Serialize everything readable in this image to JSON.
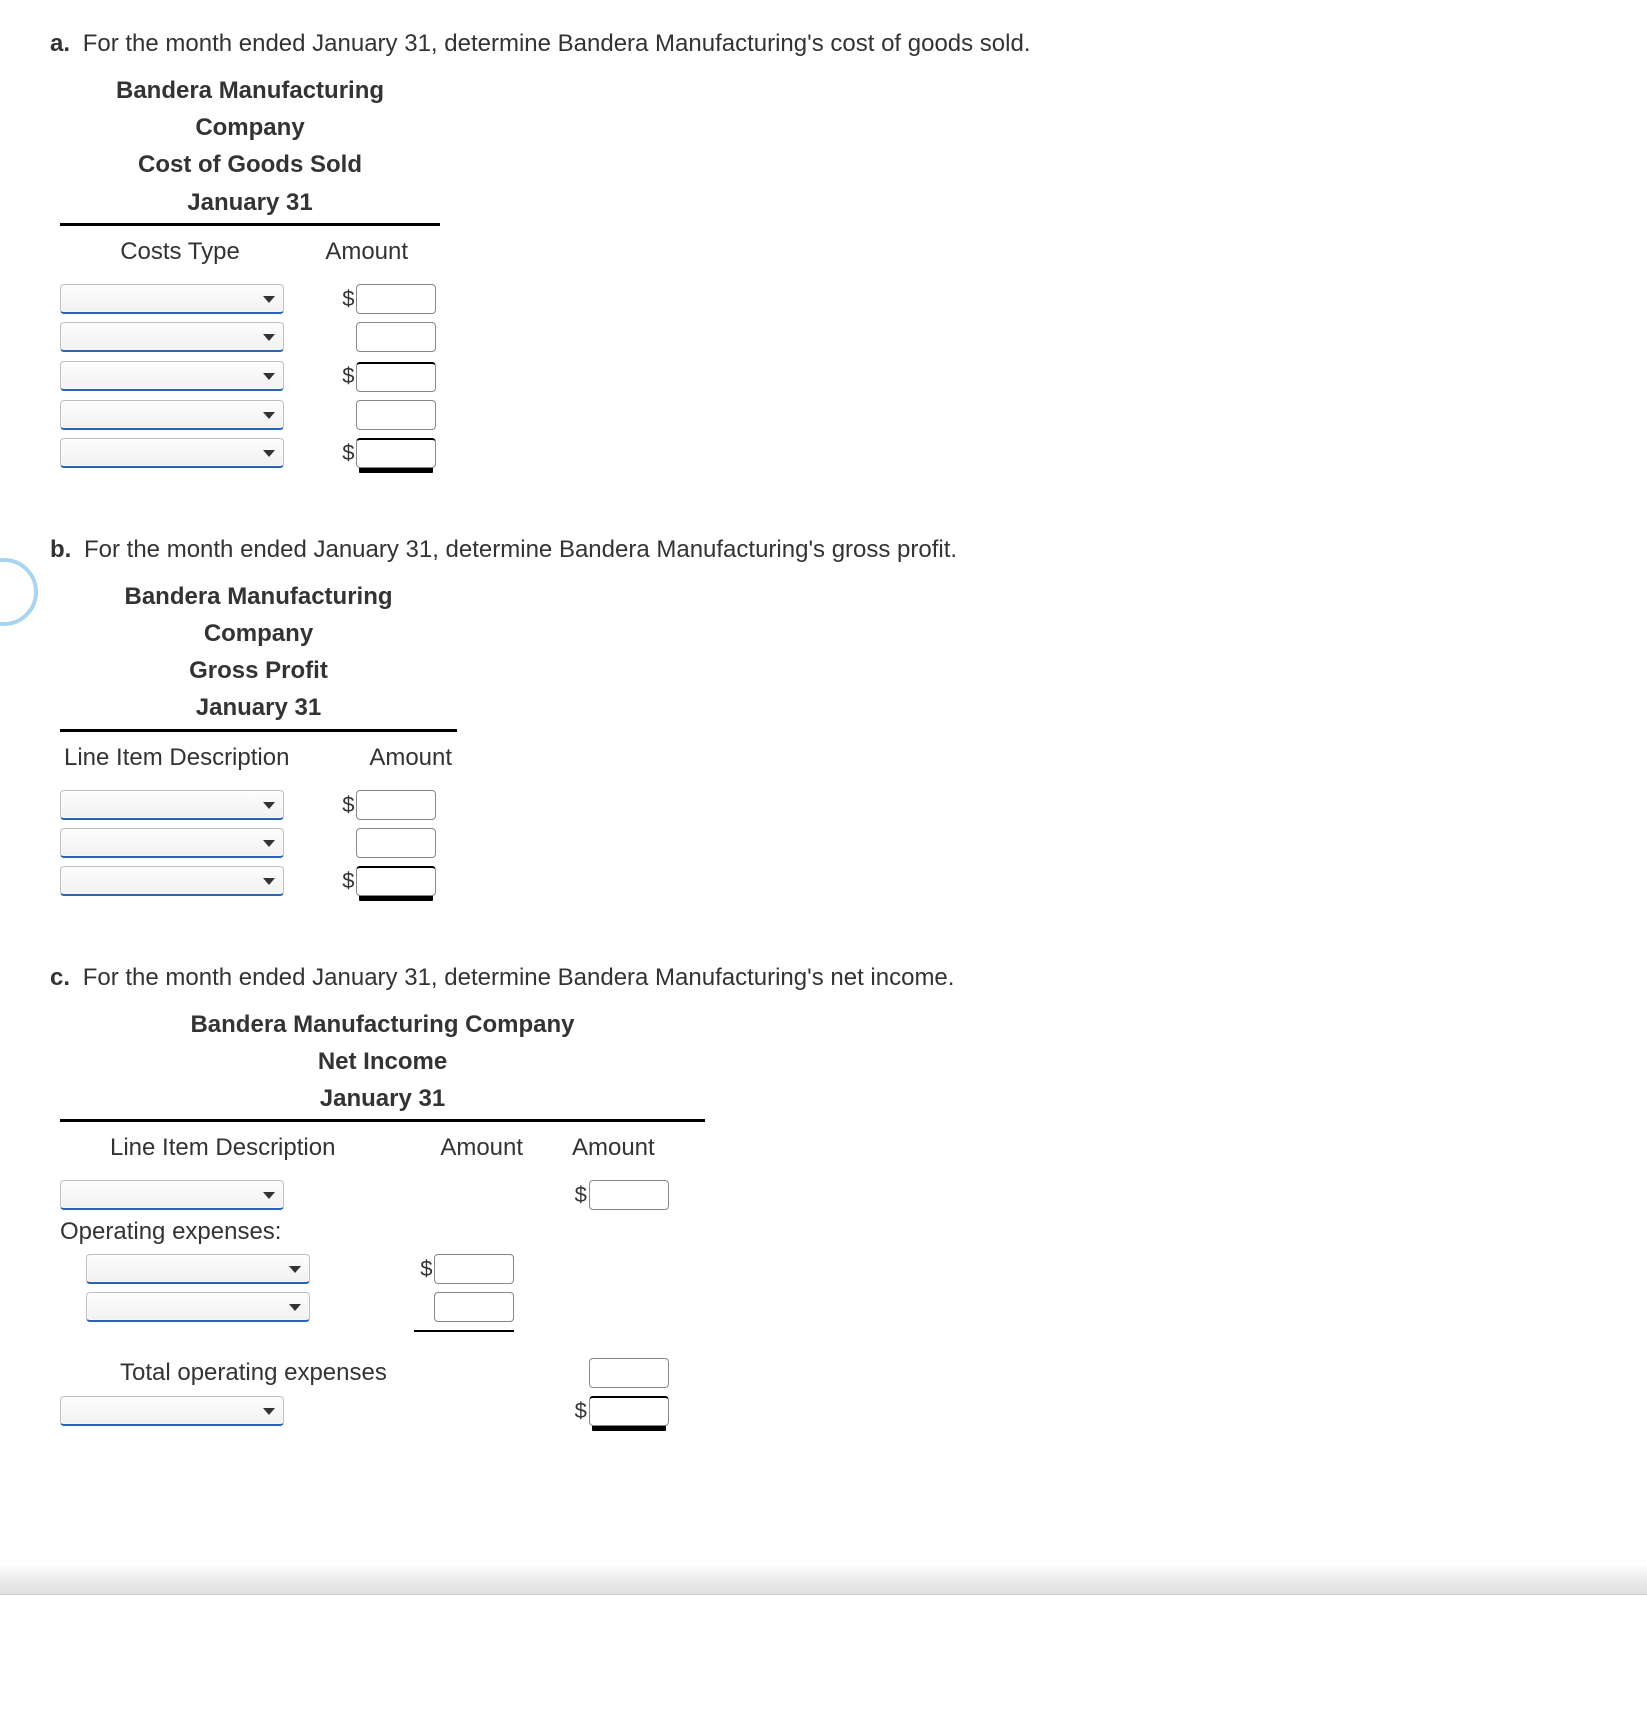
{
  "a": {
    "letter": "a.",
    "prompt": "For the month ended January 31, determine Bandera Manufacturing's cost of goods sold.",
    "title1": "Bandera Manufacturing",
    "title2": "Company",
    "title3": "Cost of Goods Sold",
    "title4": "January 31",
    "col_left": "Costs Type",
    "col_right": "Amount",
    "dollar": "$",
    "rows": [
      {
        "select": "",
        "has_dollar": true,
        "amount": ""
      },
      {
        "select": "",
        "has_dollar": false,
        "amount": ""
      },
      {
        "select": "",
        "has_dollar": true,
        "amount": ""
      },
      {
        "select": "",
        "has_dollar": false,
        "amount": ""
      },
      {
        "select": "",
        "has_dollar": true,
        "amount": "",
        "final": true
      }
    ]
  },
  "b": {
    "letter": "b.",
    "prompt": "For the month ended January 31, determine Bandera Manufacturing's gross profit.",
    "title1": "Bandera Manufacturing",
    "title2": "Company",
    "title3": "Gross Profit",
    "title4": "January 31",
    "col_left": "Line Item Description",
    "col_right": "Amount",
    "dollar": "$",
    "rows": [
      {
        "select": "",
        "has_dollar": true,
        "amount": ""
      },
      {
        "select": "",
        "has_dollar": false,
        "amount": ""
      },
      {
        "select": "",
        "has_dollar": true,
        "amount": "",
        "final": true
      }
    ]
  },
  "c": {
    "letter": "c.",
    "prompt": "For the month ended January 31, determine Bandera Manufacturing's net income.",
    "title1": "Bandera Manufacturing Company",
    "title2": "Net Income",
    "title3": "January 31",
    "col_left": "Line Item Description",
    "col_mid": "Amount",
    "col_right": "Amount",
    "opex_label": "Operating expenses:",
    "total_opex_label": "Total operating expenses",
    "dollar": "$",
    "rows": {
      "r1": {
        "select": "",
        "amount2": ""
      },
      "r2": {
        "select": "",
        "amount1": ""
      },
      "r3": {
        "select": "",
        "amount1": ""
      },
      "r4": {
        "amount2": ""
      },
      "r5": {
        "select": "",
        "amount2": ""
      }
    }
  }
}
